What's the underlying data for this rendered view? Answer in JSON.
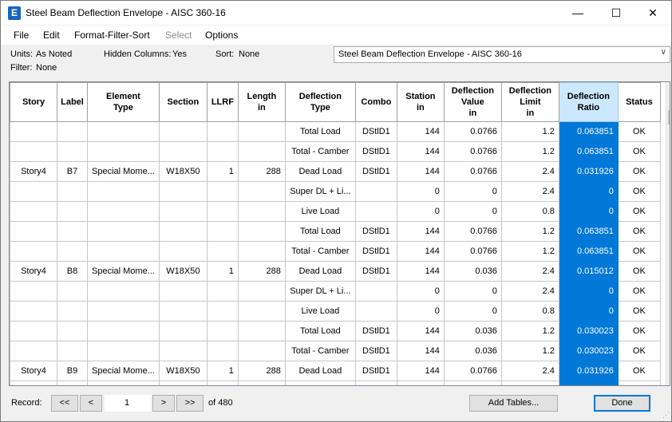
{
  "window": {
    "title": "Steel Beam Deflection Envelope - AISC 360-16",
    "icon_letter": "E"
  },
  "menu": [
    "File",
    "Edit",
    "Format-Filter-Sort",
    "Select",
    "Options"
  ],
  "info": {
    "units_label": "Units:",
    "units_value": "As Noted",
    "hidden_label": "Hidden Columns:",
    "hidden_value": "Yes",
    "sort_label": "Sort:",
    "sort_value": "None",
    "filter_label": "Filter:",
    "filter_value": "None"
  },
  "table_select": {
    "value": "Steel Beam Deflection Envelope - AISC 360-16"
  },
  "columns": [
    [
      "Story"
    ],
    [
      "Label"
    ],
    [
      "Element",
      "Type"
    ],
    [
      "Section"
    ],
    [
      "LLRF"
    ],
    [
      "Length",
      "in"
    ],
    [
      "Deflection",
      "Type"
    ],
    [
      "Combo"
    ],
    [
      "Station",
      "in"
    ],
    [
      "Deflection",
      "Value",
      "in"
    ],
    [
      "Deflection",
      "Limit",
      "in"
    ],
    [
      "Deflection",
      "Ratio"
    ],
    [
      "Status"
    ]
  ],
  "rows": [
    [
      "",
      "",
      "",
      "",
      "",
      "",
      "Total Load",
      "DStlD1",
      "144",
      "0.0766",
      "1.2",
      "0.063851",
      "OK"
    ],
    [
      "",
      "",
      "",
      "",
      "",
      "",
      "Total - Camber",
      "DStlD1",
      "144",
      "0.0766",
      "1.2",
      "0.063851",
      "OK"
    ],
    [
      "Story4",
      "B7",
      "Special Mome...",
      "W18X50",
      "1",
      "288",
      "Dead Load",
      "DStlD1",
      "144",
      "0.0766",
      "2.4",
      "0.031926",
      "OK"
    ],
    [
      "",
      "",
      "",
      "",
      "",
      "",
      "Super DL + Li...",
      "",
      "0",
      "0",
      "2.4",
      "0",
      "OK"
    ],
    [
      "",
      "",
      "",
      "",
      "",
      "",
      "Live Load",
      "",
      "0",
      "0",
      "0.8",
      "0",
      "OK"
    ],
    [
      "",
      "",
      "",
      "",
      "",
      "",
      "Total Load",
      "DStlD1",
      "144",
      "0.0766",
      "1.2",
      "0.063851",
      "OK"
    ],
    [
      "",
      "",
      "",
      "",
      "",
      "",
      "Total - Camber",
      "DStlD1",
      "144",
      "0.0766",
      "1.2",
      "0.063851",
      "OK"
    ],
    [
      "Story4",
      "B8",
      "Special Mome...",
      "W18X50",
      "1",
      "288",
      "Dead Load",
      "DStlD1",
      "144",
      "0.036",
      "2.4",
      "0.015012",
      "OK"
    ],
    [
      "",
      "",
      "",
      "",
      "",
      "",
      "Super DL + Li...",
      "",
      "0",
      "0",
      "2.4",
      "0",
      "OK"
    ],
    [
      "",
      "",
      "",
      "",
      "",
      "",
      "Live Load",
      "",
      "0",
      "0",
      "0.8",
      "0",
      "OK"
    ],
    [
      "",
      "",
      "",
      "",
      "",
      "",
      "Total Load",
      "DStlD1",
      "144",
      "0.036",
      "1.2",
      "0.030023",
      "OK"
    ],
    [
      "",
      "",
      "",
      "",
      "",
      "",
      "Total - Camber",
      "DStlD1",
      "144",
      "0.036",
      "1.2",
      "0.030023",
      "OK"
    ],
    [
      "Story4",
      "B9",
      "Special Mome...",
      "W18X50",
      "1",
      "288",
      "Dead Load",
      "DStlD1",
      "144",
      "0.0766",
      "2.4",
      "0.031926",
      "OK"
    ],
    [
      "",
      "",
      "",
      "",
      "",
      "",
      "",
      "",
      "",
      "",
      "",
      "",
      ""
    ]
  ],
  "footer": {
    "record_label": "Record:",
    "first": "<<",
    "prev": "<",
    "record_value": "1",
    "next": ">",
    "last": ">>",
    "of_text": "of 480",
    "add_tables": "Add Tables...",
    "done": "Done"
  }
}
